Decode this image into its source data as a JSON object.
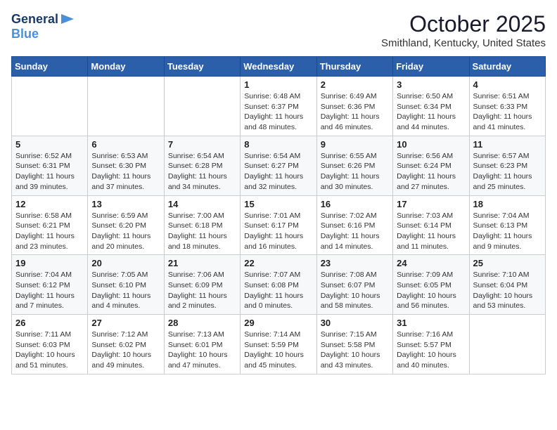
{
  "logo": {
    "line1": "General",
    "line2": "Blue"
  },
  "title": "October 2025",
  "location": "Smithland, Kentucky, United States",
  "days_of_week": [
    "Sunday",
    "Monday",
    "Tuesday",
    "Wednesday",
    "Thursday",
    "Friday",
    "Saturday"
  ],
  "weeks": [
    [
      {
        "day": "",
        "info": ""
      },
      {
        "day": "",
        "info": ""
      },
      {
        "day": "",
        "info": ""
      },
      {
        "day": "1",
        "info": "Sunrise: 6:48 AM\nSunset: 6:37 PM\nDaylight: 11 hours\nand 48 minutes."
      },
      {
        "day": "2",
        "info": "Sunrise: 6:49 AM\nSunset: 6:36 PM\nDaylight: 11 hours\nand 46 minutes."
      },
      {
        "day": "3",
        "info": "Sunrise: 6:50 AM\nSunset: 6:34 PM\nDaylight: 11 hours\nand 44 minutes."
      },
      {
        "day": "4",
        "info": "Sunrise: 6:51 AM\nSunset: 6:33 PM\nDaylight: 11 hours\nand 41 minutes."
      }
    ],
    [
      {
        "day": "5",
        "info": "Sunrise: 6:52 AM\nSunset: 6:31 PM\nDaylight: 11 hours\nand 39 minutes."
      },
      {
        "day": "6",
        "info": "Sunrise: 6:53 AM\nSunset: 6:30 PM\nDaylight: 11 hours\nand 37 minutes."
      },
      {
        "day": "7",
        "info": "Sunrise: 6:54 AM\nSunset: 6:28 PM\nDaylight: 11 hours\nand 34 minutes."
      },
      {
        "day": "8",
        "info": "Sunrise: 6:54 AM\nSunset: 6:27 PM\nDaylight: 11 hours\nand 32 minutes."
      },
      {
        "day": "9",
        "info": "Sunrise: 6:55 AM\nSunset: 6:26 PM\nDaylight: 11 hours\nand 30 minutes."
      },
      {
        "day": "10",
        "info": "Sunrise: 6:56 AM\nSunset: 6:24 PM\nDaylight: 11 hours\nand 27 minutes."
      },
      {
        "day": "11",
        "info": "Sunrise: 6:57 AM\nSunset: 6:23 PM\nDaylight: 11 hours\nand 25 minutes."
      }
    ],
    [
      {
        "day": "12",
        "info": "Sunrise: 6:58 AM\nSunset: 6:21 PM\nDaylight: 11 hours\nand 23 minutes."
      },
      {
        "day": "13",
        "info": "Sunrise: 6:59 AM\nSunset: 6:20 PM\nDaylight: 11 hours\nand 20 minutes."
      },
      {
        "day": "14",
        "info": "Sunrise: 7:00 AM\nSunset: 6:18 PM\nDaylight: 11 hours\nand 18 minutes."
      },
      {
        "day": "15",
        "info": "Sunrise: 7:01 AM\nSunset: 6:17 PM\nDaylight: 11 hours\nand 16 minutes."
      },
      {
        "day": "16",
        "info": "Sunrise: 7:02 AM\nSunset: 6:16 PM\nDaylight: 11 hours\nand 14 minutes."
      },
      {
        "day": "17",
        "info": "Sunrise: 7:03 AM\nSunset: 6:14 PM\nDaylight: 11 hours\nand 11 minutes."
      },
      {
        "day": "18",
        "info": "Sunrise: 7:04 AM\nSunset: 6:13 PM\nDaylight: 11 hours\nand 9 minutes."
      }
    ],
    [
      {
        "day": "19",
        "info": "Sunrise: 7:04 AM\nSunset: 6:12 PM\nDaylight: 11 hours\nand 7 minutes."
      },
      {
        "day": "20",
        "info": "Sunrise: 7:05 AM\nSunset: 6:10 PM\nDaylight: 11 hours\nand 4 minutes."
      },
      {
        "day": "21",
        "info": "Sunrise: 7:06 AM\nSunset: 6:09 PM\nDaylight: 11 hours\nand 2 minutes."
      },
      {
        "day": "22",
        "info": "Sunrise: 7:07 AM\nSunset: 6:08 PM\nDaylight: 11 hours\nand 0 minutes."
      },
      {
        "day": "23",
        "info": "Sunrise: 7:08 AM\nSunset: 6:07 PM\nDaylight: 10 hours\nand 58 minutes."
      },
      {
        "day": "24",
        "info": "Sunrise: 7:09 AM\nSunset: 6:05 PM\nDaylight: 10 hours\nand 56 minutes."
      },
      {
        "day": "25",
        "info": "Sunrise: 7:10 AM\nSunset: 6:04 PM\nDaylight: 10 hours\nand 53 minutes."
      }
    ],
    [
      {
        "day": "26",
        "info": "Sunrise: 7:11 AM\nSunset: 6:03 PM\nDaylight: 10 hours\nand 51 minutes."
      },
      {
        "day": "27",
        "info": "Sunrise: 7:12 AM\nSunset: 6:02 PM\nDaylight: 10 hours\nand 49 minutes."
      },
      {
        "day": "28",
        "info": "Sunrise: 7:13 AM\nSunset: 6:01 PM\nDaylight: 10 hours\nand 47 minutes."
      },
      {
        "day": "29",
        "info": "Sunrise: 7:14 AM\nSunset: 5:59 PM\nDaylight: 10 hours\nand 45 minutes."
      },
      {
        "day": "30",
        "info": "Sunrise: 7:15 AM\nSunset: 5:58 PM\nDaylight: 10 hours\nand 43 minutes."
      },
      {
        "day": "31",
        "info": "Sunrise: 7:16 AM\nSunset: 5:57 PM\nDaylight: 10 hours\nand 40 minutes."
      },
      {
        "day": "",
        "info": ""
      }
    ]
  ]
}
